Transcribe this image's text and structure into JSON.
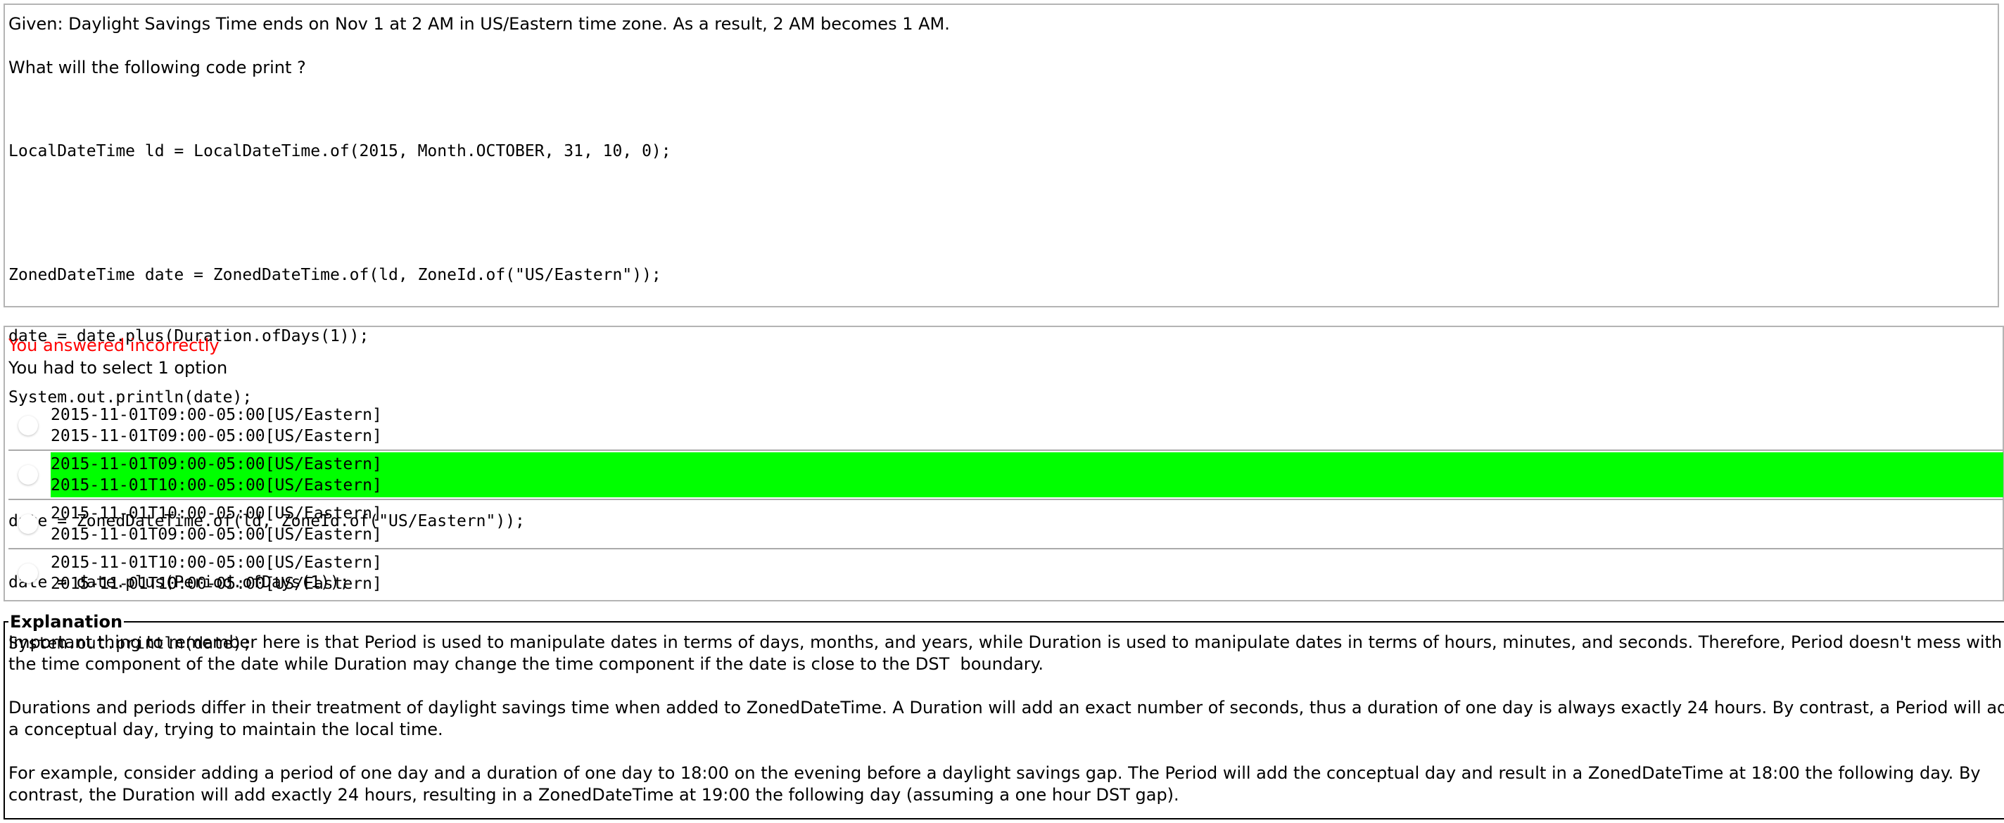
{
  "question": {
    "given": "Given: Daylight Savings Time ends on Nov 1 at 2 AM in US/Eastern time zone. As a result, 2 AM becomes 1 AM.",
    "prompt": "What will the following code print ?",
    "code_blocks": [
      [
        "LocalDateTime ld = LocalDateTime.of(2015, Month.OCTOBER, 31, 10, 0);"
      ],
      [
        "ZonedDateTime date = ZonedDateTime.of(ld, ZoneId.of(\"US/Eastern\"));",
        "date = date.plus(Duration.ofDays(1));",
        "System.out.println(date);"
      ],
      [
        "date = ZonedDateTime.of(ld, ZoneId.of(\"US/Eastern\"));",
        "date = date.plus(Period.ofDays(1));",
        "System.out.println(date);"
      ]
    ]
  },
  "result": {
    "status": "You answered incorrectly",
    "requirement": "You had to select 1 option",
    "status_color": "#ff0000",
    "correct_color": "#00ff00"
  },
  "options": [
    {
      "lines": [
        "2015-11-01T09:00-05:00[US/Eastern]",
        "2015-11-01T09:00-05:00[US/Eastern]"
      ],
      "correct": false
    },
    {
      "lines": [
        "2015-11-01T09:00-05:00[US/Eastern]",
        "2015-11-01T10:00-05:00[US/Eastern]"
      ],
      "correct": true
    },
    {
      "lines": [
        "2015-11-01T10:00-05:00[US/Eastern]",
        "2015-11-01T09:00-05:00[US/Eastern]"
      ],
      "correct": false
    },
    {
      "lines": [
        "2015-11-01T10:00-05:00[US/Eastern]",
        "2015-11-01T10:00-05:00[US/Eastern]"
      ],
      "correct": false
    }
  ],
  "explanation": {
    "title": "Explanation",
    "paragraphs": [
      [
        "Important thing to remember here is that Period is used to manipulate dates in terms of days, months, and years, while Duration is used to manipulate dates in terms of hours, minutes, and seconds. Therefore, Period doesn't mess with",
        "the time component of the date while Duration may change the time component if the date is close to the DST  boundary."
      ],
      [
        "Durations and periods differ in their treatment of daylight savings time when added to ZonedDateTime. A Duration will add an exact number of seconds, thus a duration of one day is always exactly 24 hours. By contrast, a Period will add",
        "a conceptual day, trying to maintain the local time."
      ],
      [
        "For example, consider adding a period of one day and a duration of one day to 18:00 on the evening before a daylight savings gap. The Period will add the conceptual day and result in a ZonedDateTime at 18:00 the following day. By",
        "contrast, the Duration will add exactly 24 hours, resulting in a ZonedDateTime at 19:00 the following day (assuming a one hour DST gap)."
      ]
    ]
  }
}
